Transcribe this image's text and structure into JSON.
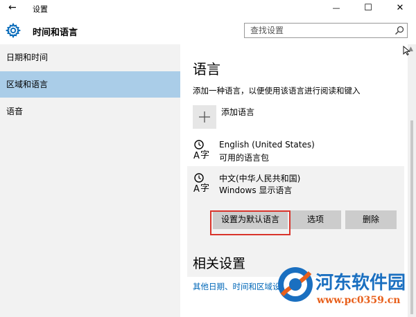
{
  "window": {
    "title": "设置",
    "back_glyph": "←",
    "minimize_glyph": "—",
    "maximize_glyph": "☐",
    "close_glyph": "✕"
  },
  "header": {
    "title": "时间和语言",
    "search_placeholder": "查找设置"
  },
  "sidebar": {
    "items": [
      {
        "label": "日期和时间"
      },
      {
        "label": "区域和语言",
        "active": true
      },
      {
        "label": "语音"
      }
    ]
  },
  "main": {
    "heading": "语言",
    "description": "添加一种语言，以便使用该语言进行阅读和键入",
    "add_language": {
      "plus": "+",
      "label": "添加语言"
    },
    "languages": [
      {
        "name": "English (United States)",
        "status": "可用的语言包",
        "icon": "language-icon"
      },
      {
        "name": "中文(中华人民共和国)",
        "status": "Windows 显示语言",
        "icon": "language-icon"
      }
    ],
    "buttons": {
      "set_default": "设置为默认语言",
      "options": "选项",
      "remove": "删除"
    },
    "related_heading": "相关设置",
    "related_link": "其他日期、时间和区域设置"
  },
  "watermark": {
    "brand": "河东软件园",
    "url": "www.pc0359.cn"
  },
  "colors": {
    "accent": "#0067b8",
    "sidebar_active": "#aacde8",
    "highlight_border": "#d9342b",
    "watermark_orange": "#e8601c",
    "watermark_blue": "#1a6fc0"
  }
}
